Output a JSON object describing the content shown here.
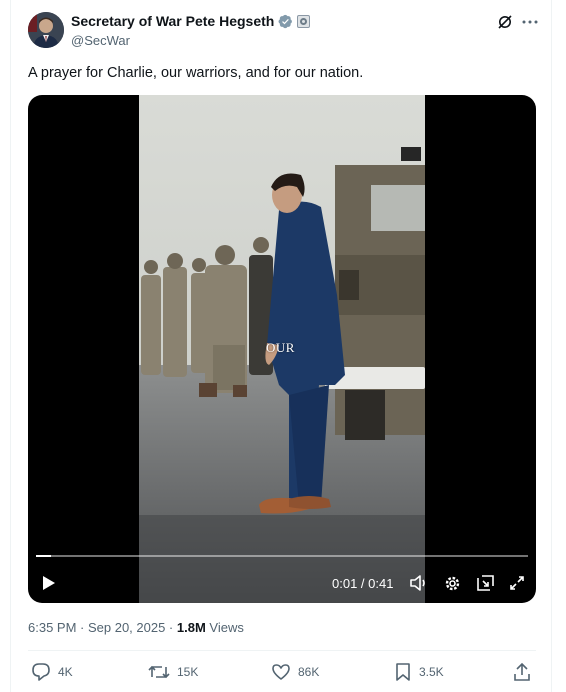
{
  "author": {
    "display_name": "Secretary of War Pete Hegseth",
    "handle": "@SecWar"
  },
  "tweet": {
    "text": "A prayer for Charlie, our warriors, and for our nation."
  },
  "video": {
    "caption": "OUR",
    "time": "0:01 / 0:41",
    "progress": 0.03
  },
  "meta": {
    "timestamp": "6:35 PM · Sep 20, 2025 · ",
    "views_count": "1.8M",
    "views_label": " Views"
  },
  "actions": {
    "replies": "4K",
    "reposts": "15K",
    "likes": "86K",
    "bookmarks": "3.5K"
  },
  "colors": {
    "verified": "#829aab",
    "secondary_text": "#536471",
    "primary_text": "#0f1419"
  }
}
